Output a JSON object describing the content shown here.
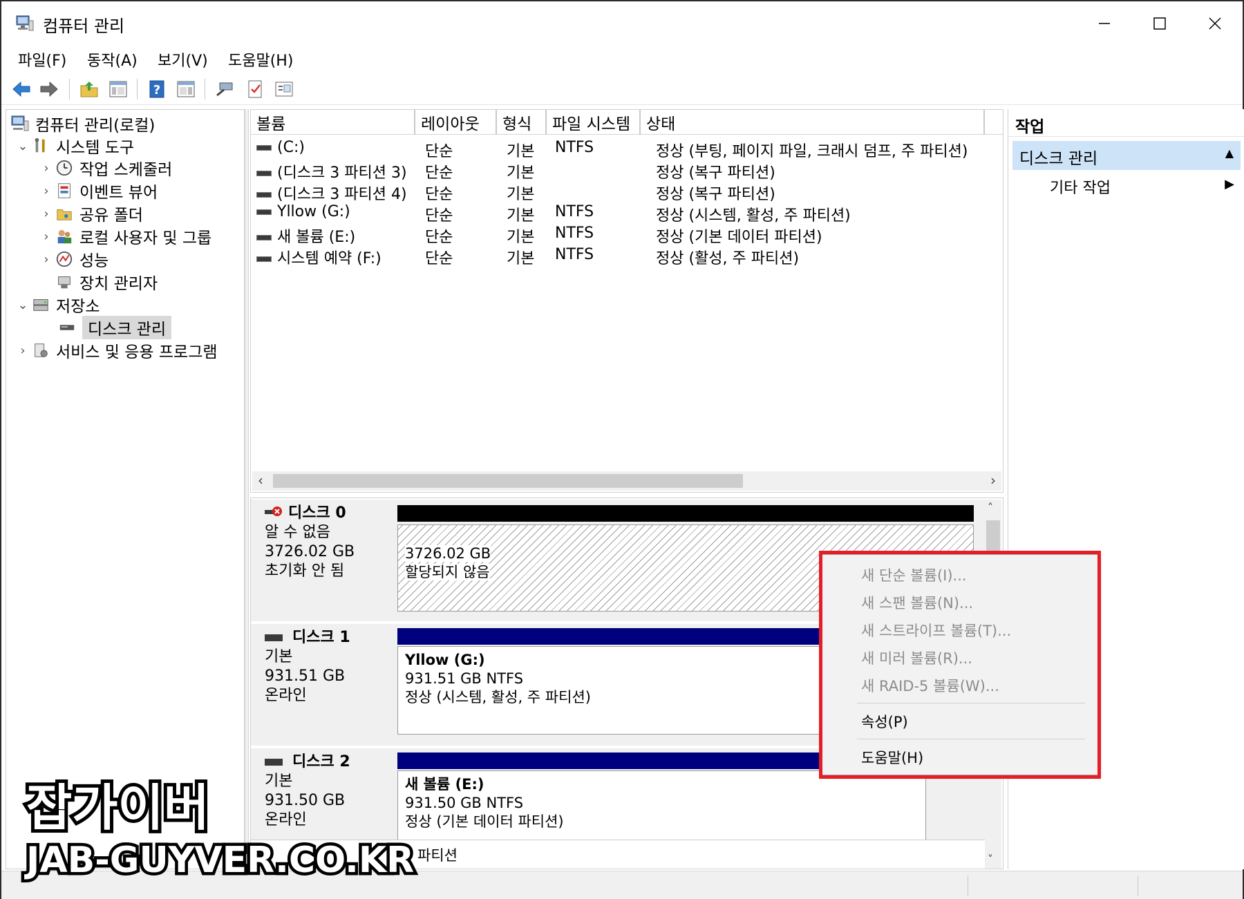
{
  "window": {
    "title": "컴퓨터 관리",
    "minimize_icon": "minimize-icon",
    "maximize_icon": "maximize-icon",
    "close_icon": "close-icon"
  },
  "menu": [
    "파일(F)",
    "동작(A)",
    "보기(V)",
    "도움말(H)"
  ],
  "toolbar": [
    "back-arrow-icon",
    "forward-arrow-icon",
    "up-folder-icon",
    "show-hide-tree-icon",
    "help-icon",
    "show-hide-action-pane-icon",
    "connect-icon",
    "checklist-icon",
    "properties-icon"
  ],
  "tree": {
    "root": "컴퓨터 관리(로컬)",
    "items": [
      {
        "label": "시스템 도구",
        "level": 1,
        "expander": "expanded",
        "icon": "tools-icon"
      },
      {
        "label": "작업 스케줄러",
        "level": 2,
        "expander": "collapsed",
        "icon": "clock-icon"
      },
      {
        "label": "이벤트 뷰어",
        "level": 2,
        "expander": "collapsed",
        "icon": "event-viewer-icon"
      },
      {
        "label": "공유 폴더",
        "level": 2,
        "expander": "collapsed",
        "icon": "shared-folder-icon"
      },
      {
        "label": "로컬 사용자 및 그룹",
        "level": 2,
        "expander": "collapsed",
        "icon": "users-icon"
      },
      {
        "label": "성능",
        "level": 2,
        "expander": "collapsed",
        "icon": "performance-icon"
      },
      {
        "label": "장치 관리자",
        "level": 2,
        "expander": "none",
        "icon": "device-manager-icon"
      },
      {
        "label": "저장소",
        "level": 1,
        "expander": "expanded",
        "icon": "storage-icon"
      },
      {
        "label": "디스크 관리",
        "level": 2,
        "expander": "none",
        "icon": "disk-management-icon",
        "selected": true
      },
      {
        "label": "서비스 및 응용 프로그램",
        "level": 1,
        "expander": "collapsed",
        "icon": "services-icon"
      }
    ]
  },
  "volume_list": {
    "columns": [
      "볼륨",
      "레이아웃",
      "형식",
      "파일 시스템",
      "상태"
    ],
    "rows": [
      [
        "(C:)",
        "단순",
        "기본",
        "NTFS",
        "정상 (부팅, 페이지 파일, 크래시 덤프, 주 파티션)"
      ],
      [
        "(디스크 3 파티션 3)",
        "단순",
        "기본",
        "",
        "정상 (복구 파티션)"
      ],
      [
        "(디스크 3 파티션 4)",
        "단순",
        "기본",
        "",
        "정상 (복구 파티션)"
      ],
      [
        "Yllow (G:)",
        "단순",
        "기본",
        "NTFS",
        "정상 (시스템, 활성, 주 파티션)"
      ],
      [
        "새 볼륨 (E:)",
        "단순",
        "기본",
        "NTFS",
        "정상 (기본 데이터 파티션)"
      ],
      [
        "시스템 예약 (F:)",
        "단순",
        "기본",
        "NTFS",
        "정상 (활성, 주 파티션)"
      ]
    ]
  },
  "disks": [
    {
      "name": "디스크 0",
      "type": "알 수 없음",
      "size": "3726.02 GB",
      "status": "초기화 안 됨",
      "icon": "disk-error-icon",
      "partition": {
        "line1": "3726.02 GB",
        "line2": "할당되지 않음",
        "line3": "",
        "bar_color": "#000000",
        "unallocated": true
      }
    },
    {
      "name": "디스크 1",
      "type": "기본",
      "size": "931.51 GB",
      "status": "온라인",
      "icon": "disk-icon",
      "partition": {
        "line1": "Yllow  (G:)",
        "line2": "931.51 GB NTFS",
        "line3": "정상 (시스템, 활성, 주 파티션)",
        "bar_color": "#00007f",
        "unallocated": false
      }
    },
    {
      "name": "디스크 2",
      "type": "기본",
      "size": "931.50 GB",
      "status": "온라인",
      "icon": "disk-icon",
      "partition": {
        "line1": "새 볼륨  (E:)",
        "line2": "931.50 GB NTFS",
        "line3": "정상 (기본 데이터 파티션)",
        "bar_color": "#00007f",
        "unallocated": false
      }
    }
  ],
  "legend_partial": "주 파티션",
  "actions": {
    "title": "작업",
    "section": "디스크 관리",
    "more": "기타 작업"
  },
  "context_menu": {
    "items": [
      {
        "label": "새 단순 볼륨(I)...",
        "enabled": false
      },
      {
        "label": "새 스팬 볼륨(N)...",
        "enabled": false
      },
      {
        "label": "새 스트라이프 볼륨(T)...",
        "enabled": false
      },
      {
        "label": "새 미러 볼륨(R)...",
        "enabled": false
      },
      {
        "label": "새 RAID-5 볼륨(W)...",
        "enabled": false
      },
      {
        "label": "속성(P)",
        "enabled": true
      },
      {
        "label": "도움말(H)",
        "enabled": true
      }
    ],
    "highlight_color": "#e51e25"
  },
  "watermark": {
    "title": "잡가이버",
    "url": "JAB-GUYVER.CO.KR"
  }
}
